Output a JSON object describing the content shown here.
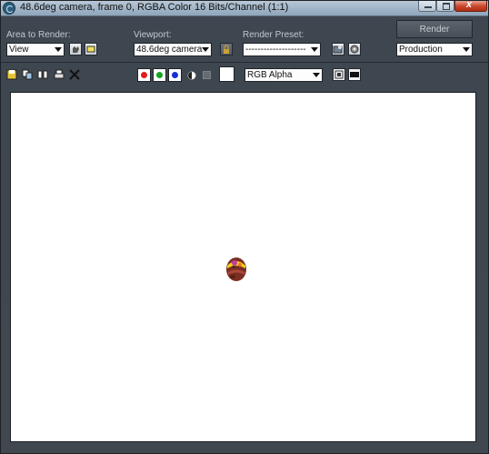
{
  "window": {
    "title": "48.6deg camera, frame 0, RGBA Color 16 Bits/Channel (1:1)",
    "close_glyph": "x"
  },
  "controls": {
    "area_to_render": {
      "label": "Area to Render:",
      "value": "View"
    },
    "viewport": {
      "label": "Viewport:",
      "value": "48.6deg camera"
    },
    "render_preset": {
      "label": "Render Preset:",
      "value": "--------------------"
    },
    "render_button": "Render",
    "render_mode": {
      "value": "Production"
    }
  },
  "toolbar": {
    "channel_display": {
      "value": "RGB Alpha"
    },
    "channels": [
      {
        "name": "red-channel",
        "color": "#e31b1b"
      },
      {
        "name": "green-channel",
        "color": "#10a81c"
      },
      {
        "name": "blue-channel",
        "color": "#1730d4"
      }
    ],
    "swatch_color": "#ffffff"
  },
  "icons": [
    "save-icon",
    "copy-icon",
    "clone-icon",
    "print-icon",
    "clear-icon",
    "region-icon",
    "crop-icon",
    "lock-icon",
    "environment-icon",
    "render-setup-icon",
    "mono-icon",
    "alpha-icon",
    "display-icon",
    "history-icon"
  ]
}
